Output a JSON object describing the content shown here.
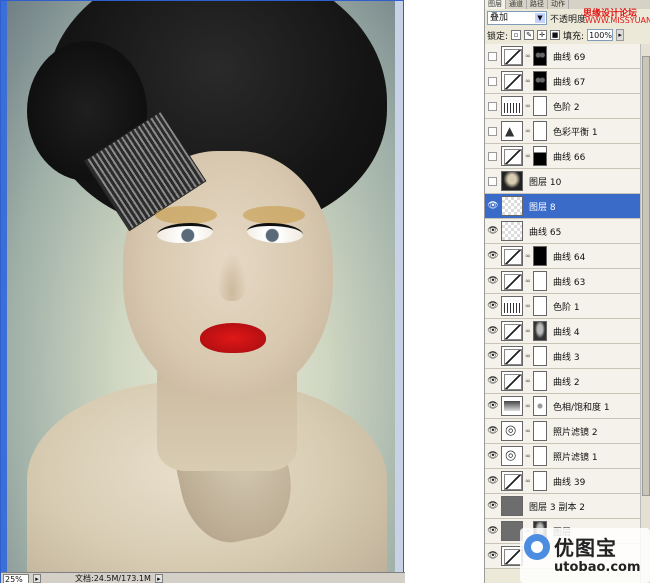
{
  "document": {
    "zoom": "25%",
    "doc_info": "文档:24.5M/173.1M"
  },
  "panel": {
    "tabs": [
      "图层",
      "通道",
      "路径",
      "动作"
    ],
    "blend_mode": "叠加",
    "opacity_label": "不透明度",
    "lock_label": "锁定:",
    "fill_label": "填充:",
    "fill_value": "100%"
  },
  "layers": [
    {
      "name": "曲线 69",
      "visible": false,
      "thumb": "curves",
      "mask": "black-dots"
    },
    {
      "name": "曲线 67",
      "visible": false,
      "thumb": "curves",
      "mask": "black-dots"
    },
    {
      "name": "色阶 2",
      "visible": false,
      "thumb": "levels",
      "mask": "white"
    },
    {
      "name": "色彩平衡 1",
      "visible": false,
      "thumb": "balance",
      "mask": "white"
    },
    {
      "name": "曲线 66",
      "visible": false,
      "thumb": "curves",
      "mask": "mostly-black"
    },
    {
      "name": "图层 10",
      "visible": false,
      "thumb": "portrait",
      "mask": "none"
    },
    {
      "name": "图层 8",
      "visible": true,
      "thumb": "checker",
      "mask": "none",
      "selected": true
    },
    {
      "name": "曲线 65",
      "visible": true,
      "thumb": "checker",
      "mask": "none"
    },
    {
      "name": "曲线 64",
      "visible": true,
      "thumb": "curves",
      "mask": "black"
    },
    {
      "name": "曲线 63",
      "visible": true,
      "thumb": "curves",
      "mask": "white"
    },
    {
      "name": "色阶 1",
      "visible": true,
      "thumb": "levels",
      "mask": "white"
    },
    {
      "name": "曲线 4",
      "visible": true,
      "thumb": "curves",
      "mask": "face"
    },
    {
      "name": "曲线 3",
      "visible": true,
      "thumb": "curves",
      "mask": "white"
    },
    {
      "name": "曲线 2",
      "visible": true,
      "thumb": "curves",
      "mask": "white"
    },
    {
      "name": "色相/饱和度 1",
      "visible": true,
      "thumb": "hue",
      "mask": "white-dot"
    },
    {
      "name": "照片滤镜 2",
      "visible": true,
      "thumb": "photofilter",
      "mask": "white"
    },
    {
      "name": "照片滤镜 1",
      "visible": true,
      "thumb": "photofilter",
      "mask": "white"
    },
    {
      "name": "曲线 39",
      "visible": true,
      "thumb": "curves",
      "mask": "white"
    },
    {
      "name": "图层 3 副本 2",
      "visible": true,
      "thumb": "gray",
      "mask": "none"
    },
    {
      "name": "图层",
      "visible": true,
      "thumb": "gray",
      "mask": "face"
    },
    {
      "name": "",
      "visible": true,
      "thumb": "curves",
      "mask": "none"
    }
  ],
  "watermark": {
    "top": "思缘设计论坛",
    "site": "WWW.MISSYUAN.COM"
  },
  "logo": {
    "cn": "优图宝",
    "en": "utobao.com"
  }
}
